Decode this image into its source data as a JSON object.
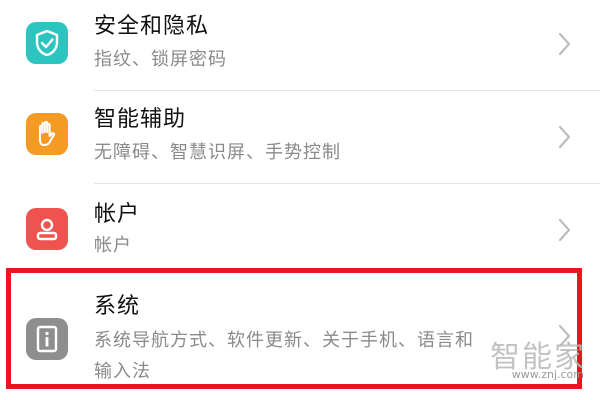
{
  "settings_list": {
    "items": [
      {
        "title": "安全和隐私",
        "subtitle": "指纹、锁屏密码",
        "icon": "shield-check-icon",
        "icon_color": "#2bc4be"
      },
      {
        "title": "智能辅助",
        "subtitle": "无障碍、智慧识屏、手势控制",
        "icon": "hand-icon",
        "icon_color": "#f59a23"
      },
      {
        "title": "帐户",
        "subtitle": "帐户",
        "icon": "account-icon",
        "icon_color": "#ef5350"
      },
      {
        "title": "系统",
        "subtitle_line1": "系统导航方式、软件更新、关于手机、语言和",
        "subtitle_line2": "输入法",
        "icon": "system-info-icon",
        "icon_color": "#8e8e8e"
      }
    ]
  },
  "highlight": {
    "color": "#e8171f"
  },
  "watermark": {
    "text": "智能家",
    "url": "www.znj.com"
  }
}
